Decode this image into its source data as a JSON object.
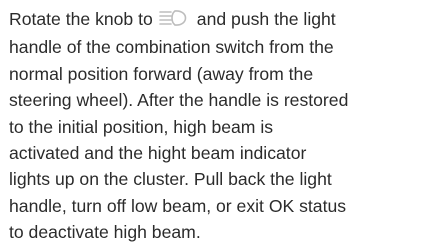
{
  "document": {
    "icon": "high-beam-icon",
    "line_1_before_icon": "Rotate the knob to",
    "line_1_after_icon": "and push the light",
    "lines": [
      "handle of the combination switch from the",
      "normal position forward (away from the",
      "steering wheel). After the handle is restored",
      "to the initial position, high beam is",
      "activated and the hight beam indicator",
      "lights up on the cluster. Pull back the light",
      "handle, turn off low beam, or exit OK status",
      "to deactivate high beam."
    ]
  }
}
